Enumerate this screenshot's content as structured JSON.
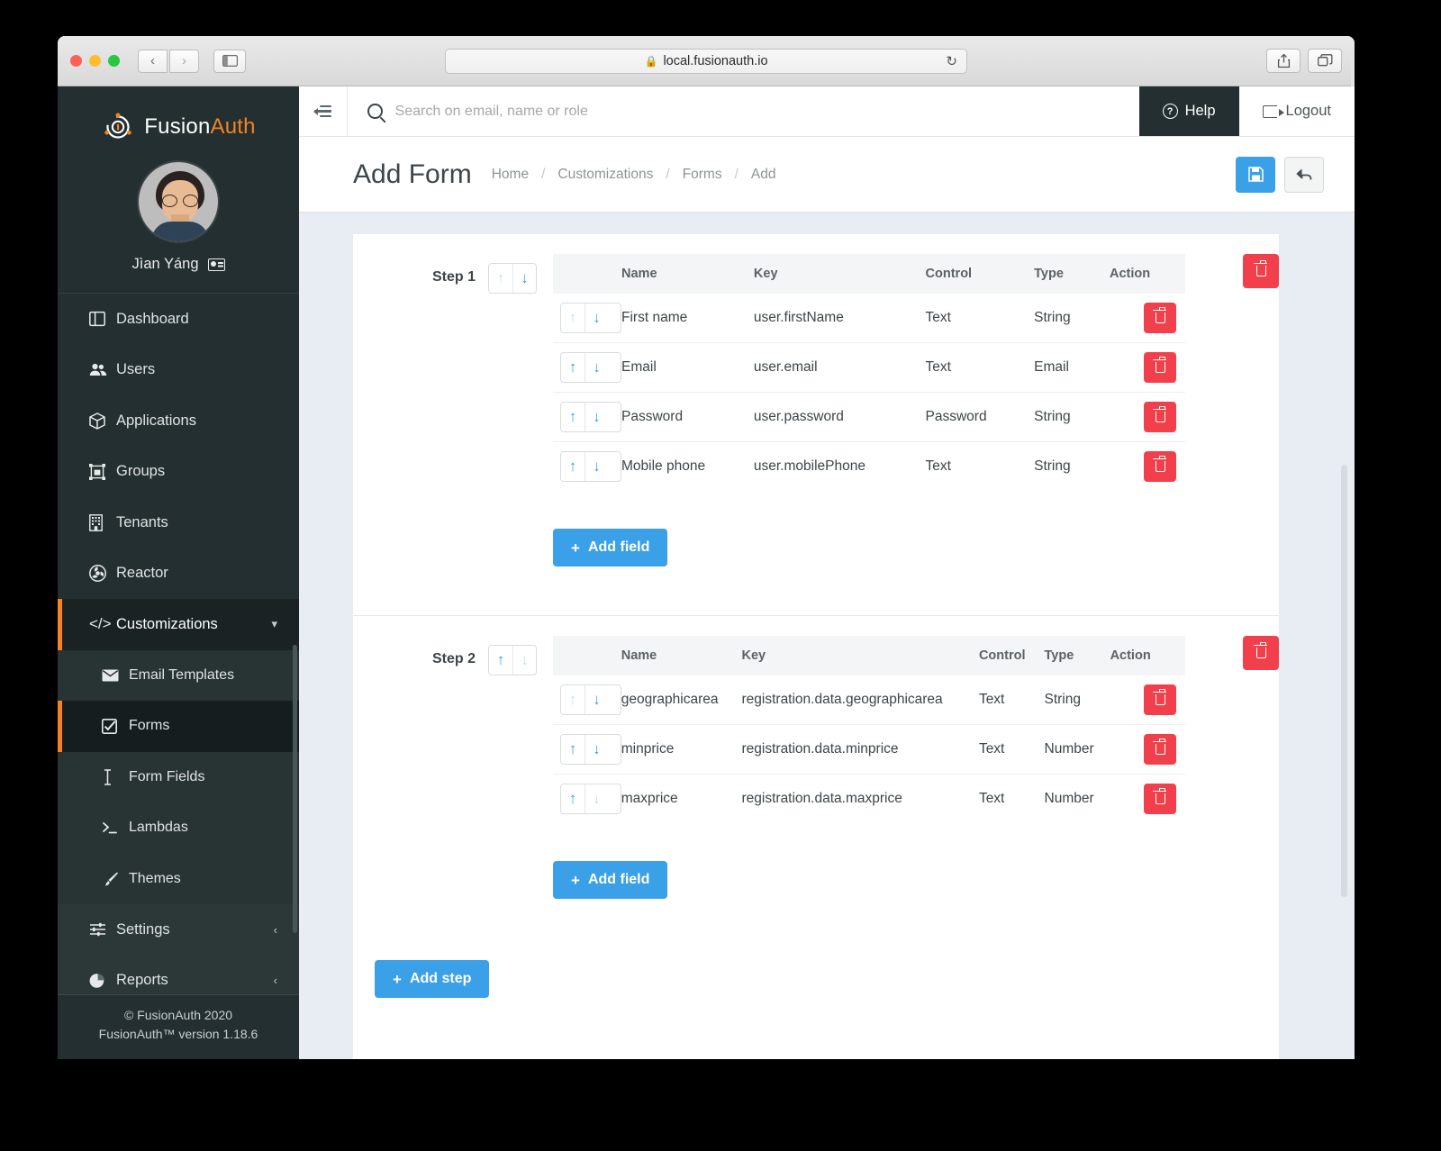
{
  "browser": {
    "url": "local.fusionauth.io",
    "lock_icon": "lock-icon",
    "reload_icon": "reload-icon",
    "back_icon": "chevron-left-icon",
    "forward_icon": "chevron-right-icon",
    "sidebar_icon": "sidebar-toggle-icon",
    "share_icon": "share-icon",
    "tabs_icon": "tab-overview-icon",
    "new_tab_icon": "plus-icon"
  },
  "sidebar": {
    "brand": {
      "first": "Fusion",
      "second": "Auth"
    },
    "user": {
      "name": "Jìan Yáng",
      "badge_icon": "id-card-icon"
    },
    "items": [
      {
        "label": "Dashboard",
        "icon": "dashboard-icon",
        "type": "top"
      },
      {
        "label": "Users",
        "icon": "users-icon",
        "type": "top"
      },
      {
        "label": "Applications",
        "icon": "box-icon",
        "type": "top"
      },
      {
        "label": "Groups",
        "icon": "groups-icon",
        "type": "top"
      },
      {
        "label": "Tenants",
        "icon": "building-icon",
        "type": "top"
      },
      {
        "label": "Reactor",
        "icon": "reactor-icon",
        "type": "top"
      },
      {
        "label": "Customizations",
        "icon": "code-icon",
        "type": "group",
        "expanded": true,
        "chevron": "chevron-down-icon"
      },
      {
        "label": "Email Templates",
        "icon": "envelope-icon",
        "type": "sub"
      },
      {
        "label": "Forms",
        "icon": "checkbox-icon",
        "type": "sub",
        "active": true
      },
      {
        "label": "Form Fields",
        "icon": "text-cursor-icon",
        "type": "sub"
      },
      {
        "label": "Lambdas",
        "icon": "terminal-icon",
        "type": "sub"
      },
      {
        "label": "Themes",
        "icon": "brush-icon",
        "type": "sub"
      },
      {
        "label": "Settings",
        "icon": "sliders-icon",
        "type": "top-collapsed",
        "chevron": "chevron-left-icon"
      },
      {
        "label": "Reports",
        "icon": "pie-chart-icon",
        "type": "top-collapsed",
        "chevron": "chevron-left-icon"
      }
    ],
    "footer": {
      "copyright": "© FusionAuth 2020",
      "version": "FusionAuth™ version 1.18.6"
    }
  },
  "topbar": {
    "menu_toggle_icon": "collapse-menu-icon",
    "search_icon": "search-icon",
    "search_placeholder": "Search on email, name or role",
    "search_value": "",
    "help_label": "Help",
    "help_icon": "question-circle-icon",
    "logout_label": "Logout",
    "logout_icon": "logout-icon"
  },
  "page": {
    "title": "Add Form",
    "breadcrumb": [
      "Home",
      "Customizations",
      "Forms",
      "Add"
    ],
    "breadcrumb_separator": "/",
    "save_icon": "save-disk-icon",
    "back_icon": "undo-arrow-icon"
  },
  "form": {
    "columns": [
      "Name",
      "Key",
      "Control",
      "Type",
      "Action"
    ],
    "move_up_icon": "arrow-up-icon",
    "move_down_icon": "arrow-down-icon",
    "delete_icon": "trash-icon",
    "add_field_label": "Add field",
    "add_step_label": "Add step",
    "plus_icon": "plus-icon",
    "steps": [
      {
        "label": "Step 1",
        "up_enabled": false,
        "down_enabled": true,
        "rows": [
          {
            "name": "First name",
            "key": "user.firstName",
            "control": "Text",
            "type": "String",
            "up_enabled": false,
            "down_enabled": true
          },
          {
            "name": "Email",
            "key": "user.email",
            "control": "Text",
            "type": "Email",
            "up_enabled": true,
            "down_enabled": true
          },
          {
            "name": "Password",
            "key": "user.password",
            "control": "Password",
            "type": "String",
            "up_enabled": true,
            "down_enabled": true
          },
          {
            "name": "Mobile phone",
            "key": "user.mobilePhone",
            "control": "Text",
            "type": "String",
            "up_enabled": true,
            "down_enabled": true
          }
        ]
      },
      {
        "label": "Step 2",
        "up_enabled": true,
        "down_enabled": false,
        "rows": [
          {
            "name": "geographicarea",
            "key": "registration.data.geographicarea",
            "control": "Text",
            "type": "String",
            "up_enabled": false,
            "down_enabled": true
          },
          {
            "name": "minprice",
            "key": "registration.data.minprice",
            "control": "Text",
            "type": "Number",
            "up_enabled": true,
            "down_enabled": true
          },
          {
            "name": "maxprice",
            "key": "registration.data.maxprice",
            "control": "Text",
            "type": "Number",
            "up_enabled": true,
            "down_enabled": false
          }
        ]
      }
    ]
  },
  "colors": {
    "accent_orange": "#f58320",
    "primary_blue": "#3aa0e8",
    "danger_red": "#f1404b",
    "sidebar_dark": "#242f31",
    "page_bg": "#e8ecf3"
  }
}
